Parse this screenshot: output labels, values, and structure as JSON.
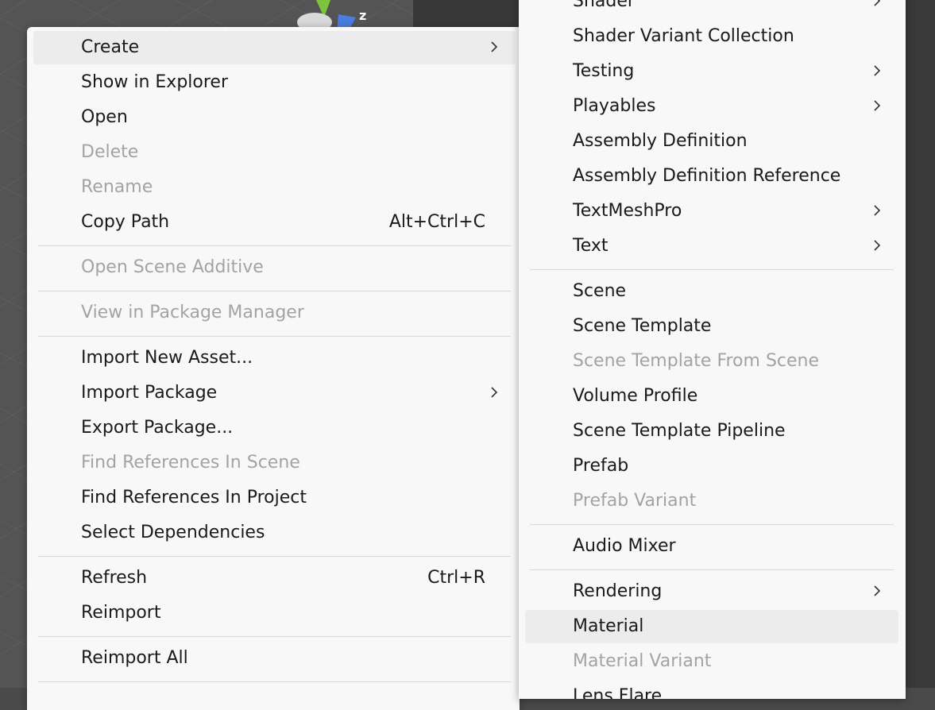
{
  "context_menu": {
    "items": [
      {
        "label": "Create",
        "submenu": true,
        "hover": true
      },
      {
        "label": "Show in Explorer"
      },
      {
        "label": "Open"
      },
      {
        "label": "Delete",
        "disabled": true
      },
      {
        "label": "Rename",
        "disabled": true
      },
      {
        "label": "Copy Path",
        "shortcut": "Alt+Ctrl+C"
      },
      {
        "separator": true
      },
      {
        "label": "Open Scene Additive",
        "disabled": true
      },
      {
        "separator": true
      },
      {
        "label": "View in Package Manager",
        "disabled": true
      },
      {
        "separator": true
      },
      {
        "label": "Import New Asset..."
      },
      {
        "label": "Import Package",
        "submenu": true
      },
      {
        "label": "Export Package..."
      },
      {
        "label": "Find References In Scene",
        "disabled": true
      },
      {
        "label": "Find References In Project"
      },
      {
        "label": "Select Dependencies"
      },
      {
        "separator": true
      },
      {
        "label": "Refresh",
        "shortcut": "Ctrl+R"
      },
      {
        "label": "Reimport"
      },
      {
        "separator": true
      },
      {
        "label": "Reimport All"
      },
      {
        "separator": true
      }
    ]
  },
  "create_submenu": {
    "items": [
      {
        "label": "Shader",
        "submenu": true
      },
      {
        "label": "Shader Variant Collection"
      },
      {
        "label": "Testing",
        "submenu": true
      },
      {
        "label": "Playables",
        "submenu": true
      },
      {
        "label": "Assembly Definition"
      },
      {
        "label": "Assembly Definition Reference"
      },
      {
        "label": "TextMeshPro",
        "submenu": true
      },
      {
        "label": "Text",
        "submenu": true
      },
      {
        "separator": true
      },
      {
        "label": "Scene"
      },
      {
        "label": "Scene Template"
      },
      {
        "label": "Scene Template From Scene",
        "disabled": true
      },
      {
        "label": "Volume Profile"
      },
      {
        "label": "Scene Template Pipeline"
      },
      {
        "label": "Prefab"
      },
      {
        "label": "Prefab Variant",
        "disabled": true
      },
      {
        "separator": true
      },
      {
        "label": "Audio Mixer"
      },
      {
        "separator": true
      },
      {
        "label": "Rendering",
        "submenu": true
      },
      {
        "label": "Material",
        "hover": true
      },
      {
        "label": "Material Variant",
        "disabled": true
      },
      {
        "label": "Lens Flare"
      }
    ]
  },
  "scene_gizmo": {
    "axis_label": "z"
  },
  "colors": {
    "menu_bg": "#f8f8f8",
    "hover_bg": "#ececec",
    "text": "#1a1a1a",
    "disabled_text": "#a3a3a3",
    "separator": "#d8d8d8"
  }
}
